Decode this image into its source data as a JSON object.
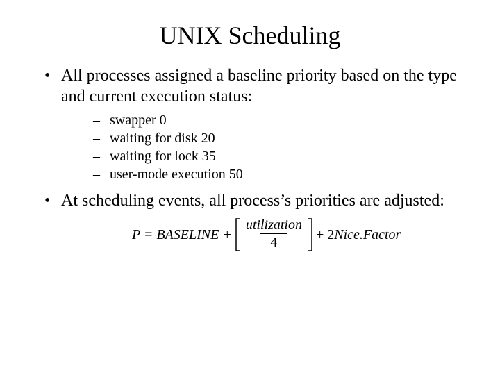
{
  "title": "UNIX Scheduling",
  "bullets": {
    "b1": "All processes assigned a baseline priority based on the type and current execution status:",
    "sub": {
      "s1": "swapper  0",
      "s2": "waiting for disk 20",
      "s3": "waiting for lock 35",
      "s4": "user-mode execution     50"
    },
    "b2": "At scheduling events, all process’s priorities are adjusted:"
  },
  "formula": {
    "lhs": "P = BASELINE +",
    "numerator": "utilization",
    "denominator": "4",
    "plus": "+",
    "two": "2",
    "rest": "Nice.Factor"
  }
}
